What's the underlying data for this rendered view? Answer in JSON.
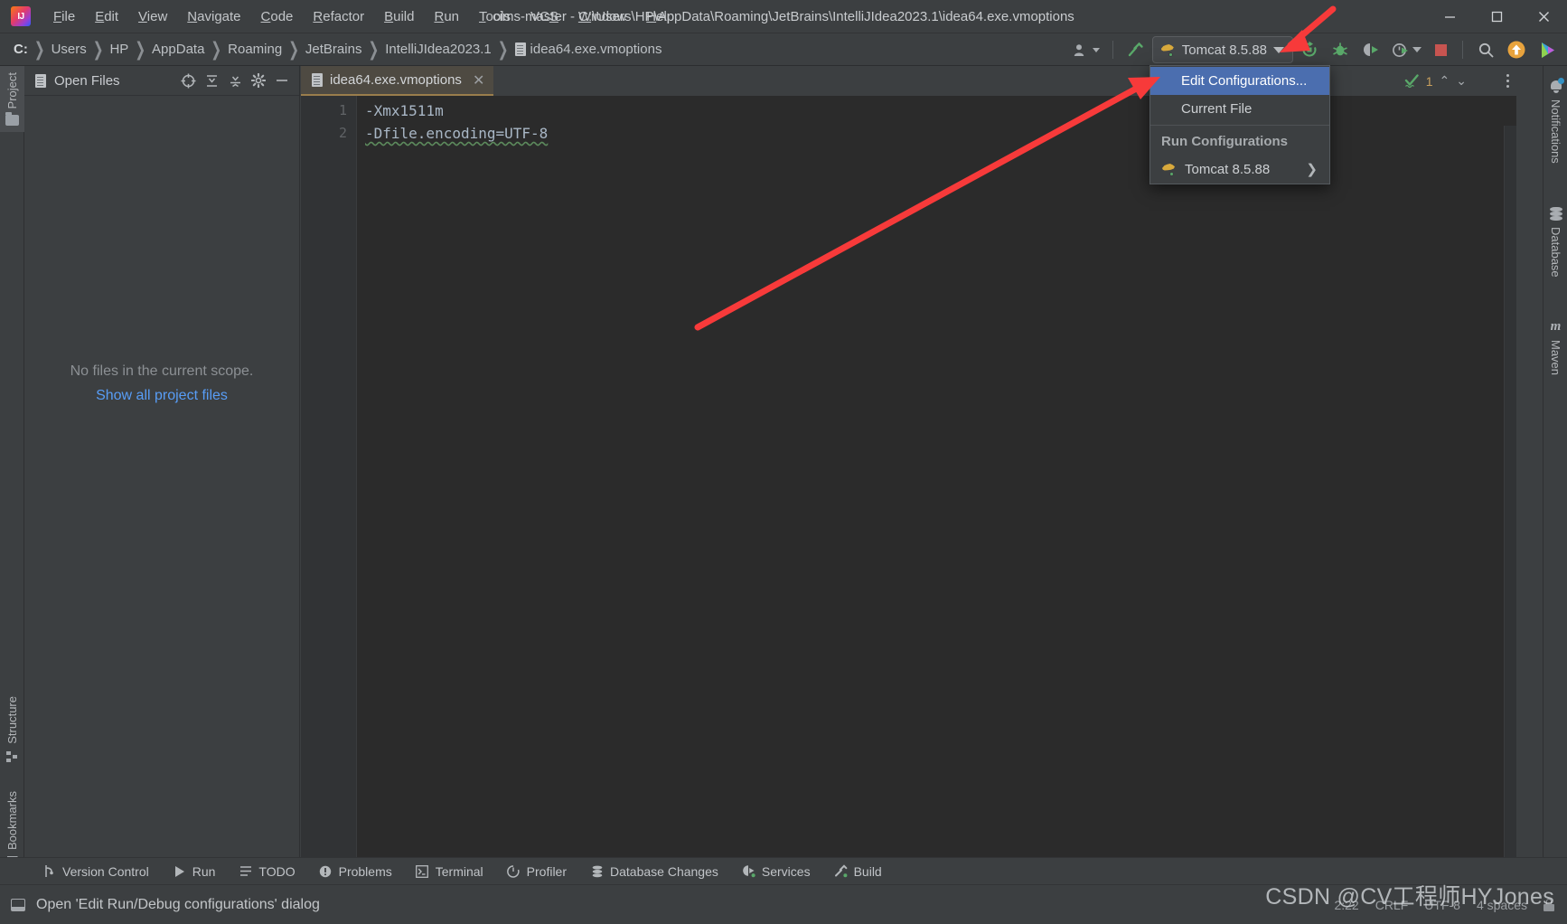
{
  "window": {
    "title": "cims-master - C:\\Users\\HP\\AppData\\Roaming\\JetBrains\\IntelliJIdea2023.1\\idea64.exe.vmoptions",
    "logo_icon": "intellij-idea-logo",
    "minimize_icon": "minimize-icon",
    "maximize_icon": "maximize-icon",
    "close_icon": "close-icon"
  },
  "menubar": {
    "items": [
      {
        "label": "File",
        "mnemonic": "F"
      },
      {
        "label": "Edit",
        "mnemonic": "E"
      },
      {
        "label": "View",
        "mnemonic": "V"
      },
      {
        "label": "Navigate",
        "mnemonic": "N"
      },
      {
        "label": "Code",
        "mnemonic": "C"
      },
      {
        "label": "Refactor",
        "mnemonic": "R"
      },
      {
        "label": "Build",
        "mnemonic": "B"
      },
      {
        "label": "Run",
        "mnemonic": "R"
      },
      {
        "label": "Tools",
        "mnemonic": "T"
      },
      {
        "label": "VCS",
        "mnemonic": "S"
      },
      {
        "label": "Window",
        "mnemonic": "W"
      },
      {
        "label": "Help",
        "mnemonic": "H"
      }
    ]
  },
  "breadcrumb": {
    "items": [
      "C:",
      "Users",
      "HP",
      "AppData",
      "Roaming",
      "JetBrains",
      "IntelliJIdea2023.1"
    ],
    "file": "idea64.exe.vmoptions",
    "file_icon": "file-icon"
  },
  "toolbar": {
    "account_icon": "user-account-icon",
    "build_icon": "hammer-build-icon",
    "run_config_label": "Tomcat 8.5.88",
    "run_config_icon": "tomcat-icon",
    "run_config_caret_icon": "caret-down-icon",
    "rerun_icon": "rerun-icon",
    "debug_icon": "debug-bug-icon",
    "run_coverage_icon": "run-with-coverage-icon",
    "profiler_icon": "profiler-clock-icon",
    "profiler_caret_icon": "caret-down-icon",
    "stop_icon": "stop-icon",
    "search_icon": "search-icon",
    "updates_icon": "update-arrow-icon",
    "ide_icon": "ide-assistant-icon"
  },
  "run_config_menu": {
    "edit_configurations": "Edit Configurations...",
    "current_file": "Current File",
    "group_header": "Run Configurations",
    "configurations": [
      {
        "label": "Tomcat 8.5.88",
        "icon": "tomcat-icon",
        "submenu_icon": "chevron-right-icon"
      }
    ]
  },
  "left_tool_strip": {
    "items": [
      {
        "label": "Project",
        "icon": "project-folder-icon",
        "active": true
      },
      {
        "label": "Structure",
        "icon": "structure-icon",
        "active": false
      },
      {
        "label": "Bookmarks",
        "icon": "bookmark-icon",
        "active": false
      }
    ],
    "bottom_icon": "tool-window-layout-icon"
  },
  "right_tool_strip": {
    "items": [
      {
        "label": "Notifications",
        "icon": "notification-bell-icon"
      },
      {
        "label": "Database",
        "icon": "database-icon"
      },
      {
        "label": "Maven",
        "icon": "maven-icon"
      }
    ]
  },
  "project_panel": {
    "title": "Open Files",
    "title_icon": "file-icon",
    "header_icons": [
      "scope-target-icon",
      "expand-all-icon",
      "collapse-all-icon",
      "settings-gear-icon",
      "hide-panel-icon"
    ],
    "empty_message": "No files in the current scope.",
    "empty_link": "Show all project files"
  },
  "editor": {
    "tab_label": "idea64.exe.vmoptions",
    "tab_icon": "file-icon",
    "tab_close_icon": "close-icon",
    "tab_options_icon": "kebab-menu-icon",
    "lines": [
      {
        "number": "1",
        "text": "-Xmx1511m",
        "warning": false
      },
      {
        "number": "2",
        "text": "-Dfile.encoding=UTF-8",
        "warning": true
      }
    ],
    "inspection": {
      "icon": "inspection-checkmark-icon",
      "count": "1",
      "prev_icon": "chevron-up-icon",
      "next_icon": "chevron-down-icon"
    }
  },
  "bottom_tool_bar": {
    "items": [
      {
        "label": "Version Control",
        "icon": "version-control-branch-icon"
      },
      {
        "label": "Run",
        "icon": "run-play-icon"
      },
      {
        "label": "TODO",
        "icon": "todo-list-icon"
      },
      {
        "label": "Problems",
        "icon": "problems-warning-icon"
      },
      {
        "label": "Terminal",
        "icon": "terminal-icon"
      },
      {
        "label": "Profiler",
        "icon": "profiler-icon"
      },
      {
        "label": "Database Changes",
        "icon": "database-changes-icon"
      },
      {
        "label": "Services",
        "icon": "services-icon"
      },
      {
        "label": "Build",
        "icon": "build-hammer-icon"
      }
    ]
  },
  "status_bar": {
    "icon": "status-panel-icon",
    "message": "Open 'Edit Run/Debug configurations' dialog",
    "caret_position": "2:22",
    "line_separator": "CRLF",
    "encoding": "UTF-8",
    "indent": "4 spaces",
    "lock_icon": "read-only-lock-icon"
  },
  "watermark": {
    "text": "CSDN @CV工程师HYJones"
  },
  "colors": {
    "background": "#3c3f41",
    "editor_background": "#2b2b2b",
    "selection_blue": "#4b6eaf",
    "link_blue": "#589df6",
    "annotation_red": "#f73a3a",
    "tab_active": "#4e4a42",
    "green_accent": "#59a869"
  }
}
